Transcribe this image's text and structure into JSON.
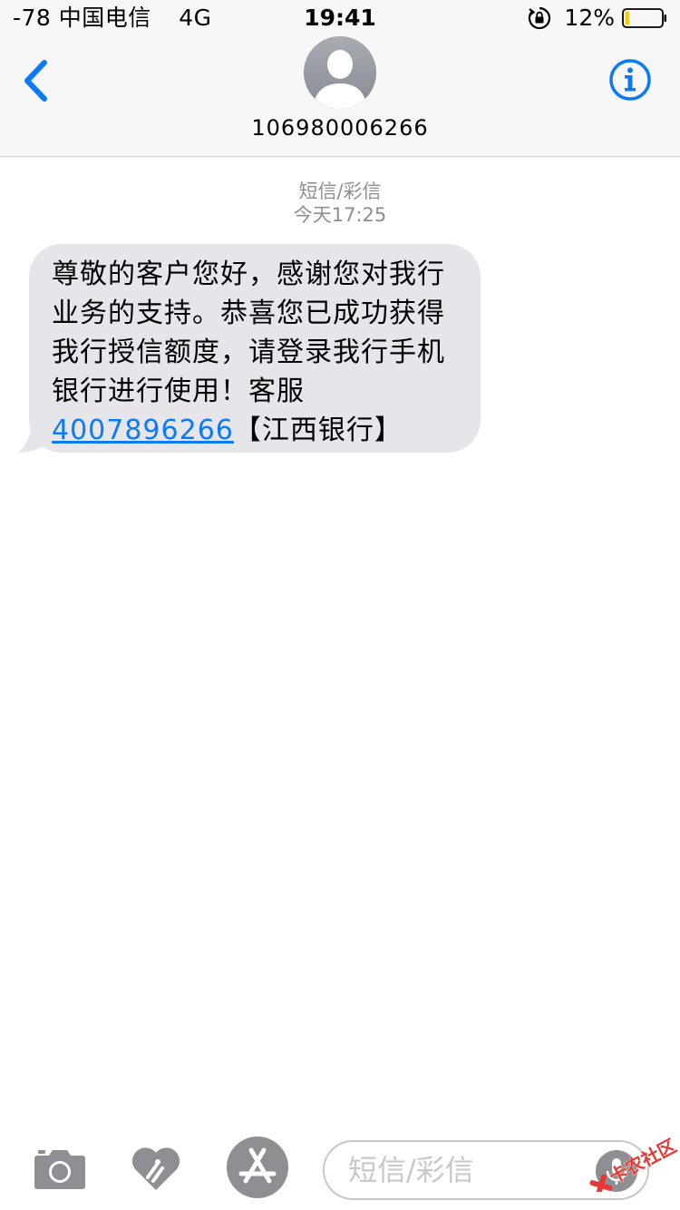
{
  "status_bar": {
    "signal": "-78",
    "carrier": "中国电信",
    "network": "4G",
    "time": "19:41",
    "battery_percent": "12%",
    "battery_level": 0.12
  },
  "nav": {
    "contact": "106980006266",
    "icons": [
      "chevron-left-icon",
      "person-avatar-icon",
      "info-icon"
    ]
  },
  "conversation": {
    "message_type": "短信/彩信",
    "timestamp": "今天17:25",
    "message": {
      "text_before": "尊敬的客户您好，感谢您对我行业务的支持。恭喜您已成功获得我行授信额度，请登录我行手机银行进行使用！客服",
      "phone": "4007896266",
      "text_after": "【江西银行】"
    }
  },
  "input_bar": {
    "placeholder": "短信/彩信",
    "icons": [
      "camera-icon",
      "digital-touch-icon",
      "app-store-icon",
      "microphone-icon"
    ]
  },
  "watermark": {
    "text": "卡农社区"
  },
  "colors": {
    "accent": "#0b7bf5",
    "bubble": "#e5e5ea",
    "meta_text": "#8e8e93",
    "battery_fill": "#ffcc00"
  }
}
